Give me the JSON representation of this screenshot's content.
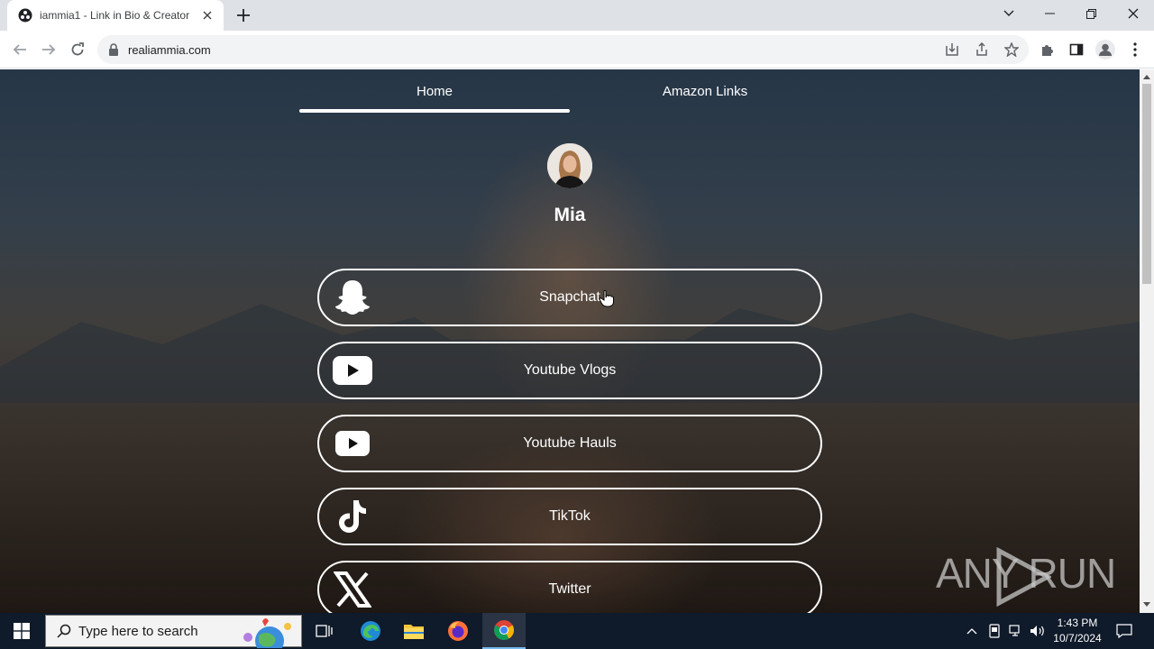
{
  "browser": {
    "tab_title": "iammia1 - Link in Bio & Creator",
    "url": "realiammia.com"
  },
  "page": {
    "nav_tabs": [
      "Home",
      "Amazon Links"
    ],
    "active_tab": "Home",
    "profile_name": "Mia",
    "links": [
      {
        "label": "Snapchat",
        "icon": "snapchat-icon"
      },
      {
        "label": "Youtube Vlogs",
        "icon": "youtube-icon"
      },
      {
        "label": "Youtube Hauls",
        "icon": "youtube-icon"
      },
      {
        "label": "TikTok",
        "icon": "tiktok-icon"
      },
      {
        "label": "Twitter",
        "icon": "x-twitter-icon"
      }
    ],
    "watermark": "ANY RUN"
  },
  "taskbar": {
    "search_placeholder": "Type here to search",
    "time": "1:43 PM",
    "date": "10/7/2024"
  },
  "colors": {
    "taskbar": "#0f1a2a",
    "tabstrip": "#dee1e6",
    "button_border": "#ffffff"
  }
}
